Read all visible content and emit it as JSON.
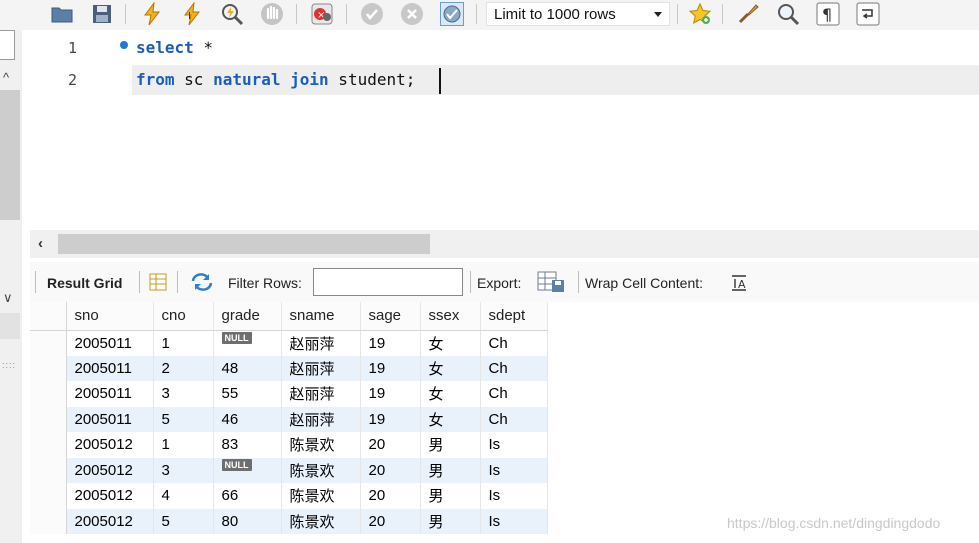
{
  "toolbar": {
    "limit_select": {
      "value": "Limit to 1000 rows"
    },
    "icons": [
      "folder-icon",
      "save-icon",
      "execute-icon",
      "execute-current-icon",
      "explain-icon",
      "stop-icon",
      "toggle-error-icon",
      "commit-icon",
      "rollback-icon",
      "autocommit-icon",
      "favorite-icon",
      "beautify-icon",
      "find-icon",
      "invisible-chars-icon",
      "wrap-icon"
    ]
  },
  "editor": {
    "line_numbers": [
      "1",
      "2"
    ],
    "lines": [
      {
        "kw1": "select",
        "rest": " *"
      },
      {
        "kw1": "from",
        "t1": " sc ",
        "kw2": "natural",
        "t2": " ",
        "kw3": "join",
        "t3": " student;"
      }
    ]
  },
  "result_toolbar": {
    "result_grid_label": "Result Grid",
    "filter_label": "Filter Rows:",
    "filter_value": "",
    "export_label": "Export:",
    "wrap_label": "Wrap Cell Content:"
  },
  "grid": {
    "null_label": "NULL",
    "columns": [
      "sno",
      "cno",
      "grade",
      "sname",
      "sage",
      "ssex",
      "sdept"
    ],
    "rows": [
      [
        "2005011",
        "1",
        null,
        "赵丽萍",
        "19",
        "女",
        "Ch"
      ],
      [
        "2005011",
        "2",
        "48",
        "赵丽萍",
        "19",
        "女",
        "Ch"
      ],
      [
        "2005011",
        "3",
        "55",
        "赵丽萍",
        "19",
        "女",
        "Ch"
      ],
      [
        "2005011",
        "5",
        "46",
        "赵丽萍",
        "19",
        "女",
        "Ch"
      ],
      [
        "2005012",
        "1",
        "83",
        "陈景欢",
        "20",
        "男",
        "Is"
      ],
      [
        "2005012",
        "3",
        null,
        "陈景欢",
        "20",
        "男",
        "Is"
      ],
      [
        "2005012",
        "4",
        "66",
        "陈景欢",
        "20",
        "男",
        "Is"
      ],
      [
        "2005012",
        "5",
        "80",
        "陈景欢",
        "20",
        "男",
        "Is"
      ]
    ]
  },
  "watermark": "https://blog.csdn.net/dingdingdodo"
}
